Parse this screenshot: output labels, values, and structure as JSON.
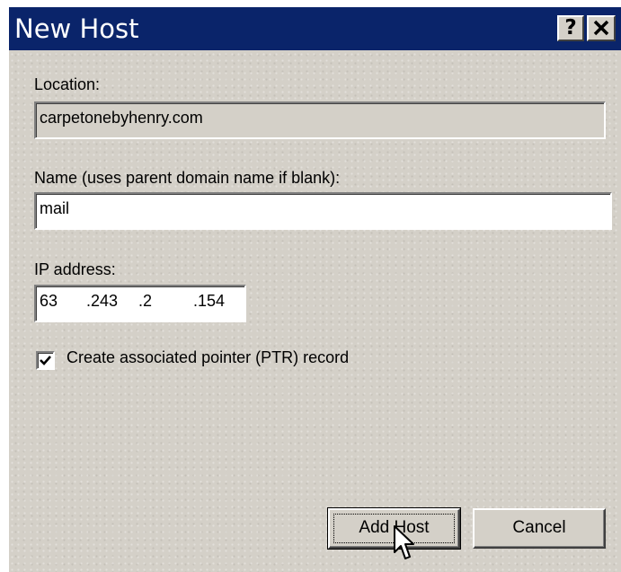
{
  "window": {
    "title": "New Host",
    "help_glyph": "?",
    "close_glyph": "✕"
  },
  "location": {
    "label": "Location:",
    "value": "carpetonebyhenry.com"
  },
  "name": {
    "label": "Name (uses parent domain name if blank):",
    "value": "mail"
  },
  "ip": {
    "label": "IP address:",
    "octets": [
      "63",
      ".243",
      ".2",
      ".154"
    ]
  },
  "ptr": {
    "label": "Create associated pointer (PTR) record",
    "checked": true
  },
  "buttons": {
    "add_host": "Add Host",
    "cancel": "Cancel"
  },
  "icons": [
    "help-icon",
    "close-icon",
    "checkmark-icon",
    "mouse-pointer-icon"
  ],
  "colors": {
    "titlebar": "#0a246a",
    "dialog_face": "#d4d0c8",
    "field_bg": "#ffffff"
  }
}
